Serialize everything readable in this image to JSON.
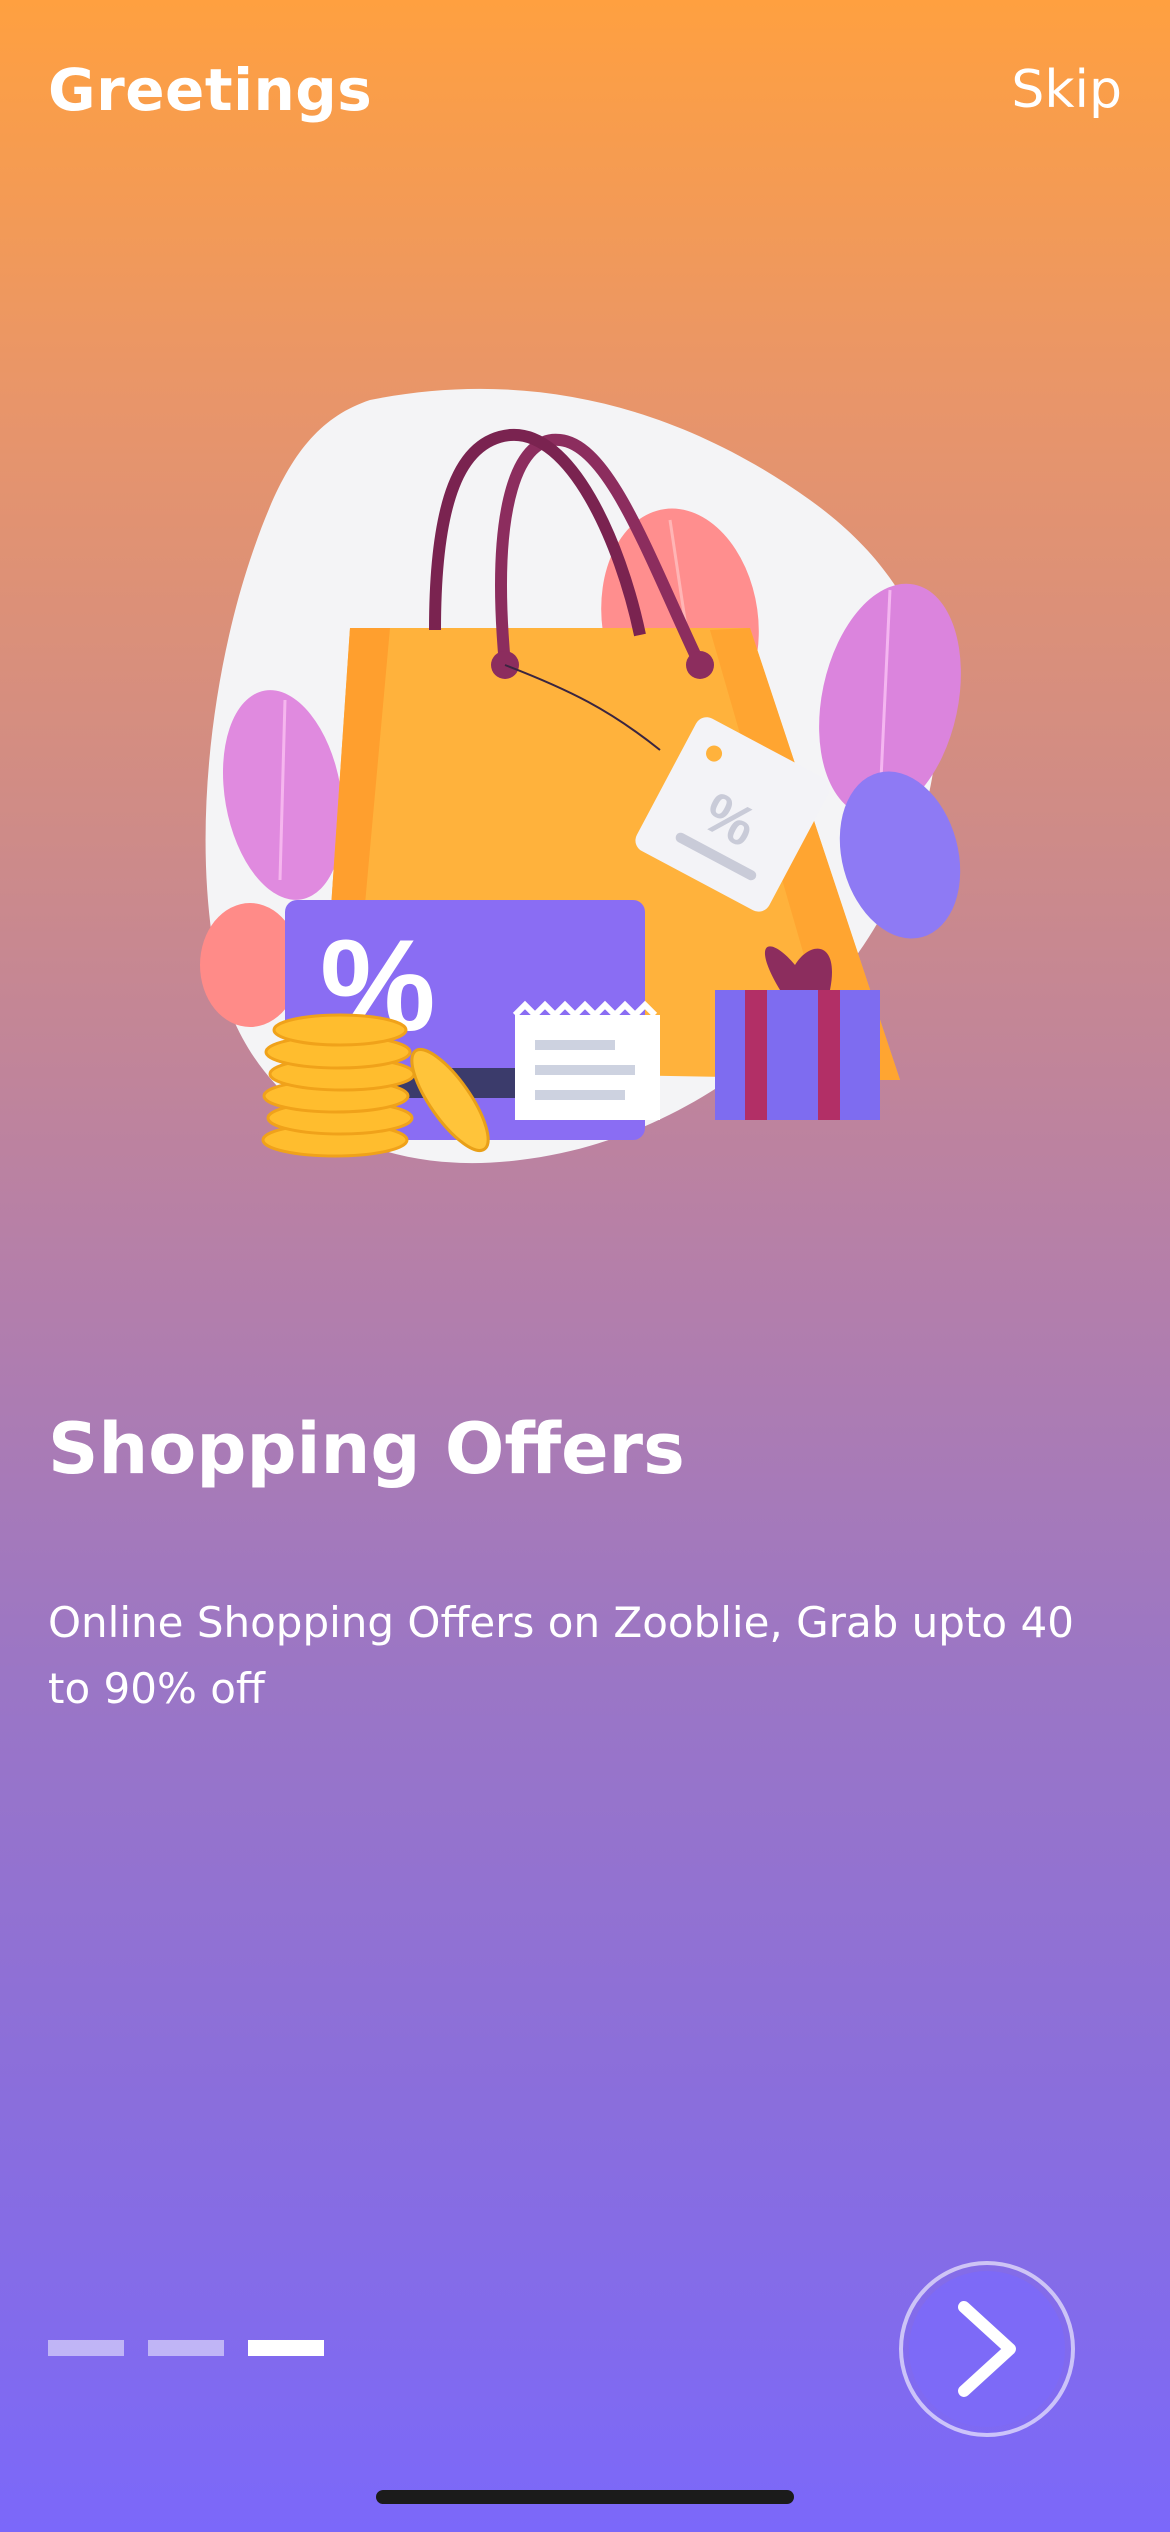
{
  "header": {
    "title": "Greetings",
    "skip_label": "Skip"
  },
  "onboarding": {
    "headline": "Shopping Offers",
    "description": "Online Shopping Offers on Zooblie, Grab upto 40 to 90% off",
    "illustration_text": "%",
    "page_count": 3,
    "active_page": 3
  },
  "icons": {
    "next": "chevron-right-icon"
  },
  "colors": {
    "gradient_top": "#FFA040",
    "gradient_bottom": "#7B68FA",
    "accent": "#7D6AF7",
    "text": "#FFFFFF"
  }
}
